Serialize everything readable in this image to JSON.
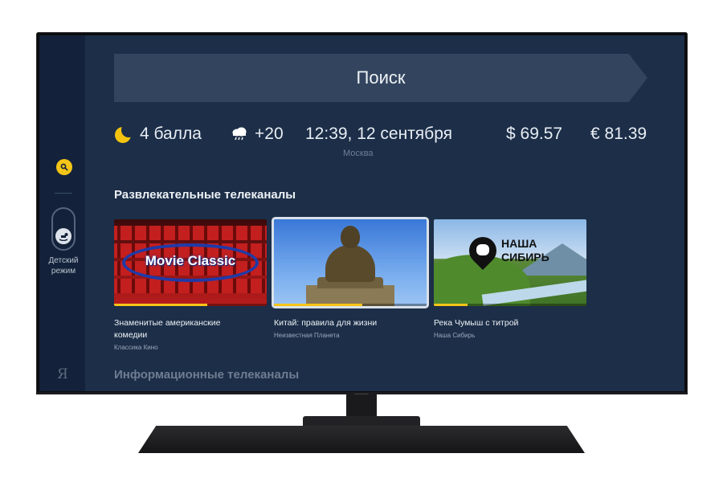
{
  "sidebar": {
    "search_icon": "search-icon",
    "kids_mode_label_1": "Детский",
    "kids_mode_label_2": "режим",
    "logo": "Я"
  },
  "search": {
    "label": "Поиск"
  },
  "info_bar": {
    "traffic_icon": "moon-icon",
    "traffic": "4 балла",
    "weather_icon": "rain-cloud-icon",
    "temperature": "+20",
    "datetime": "12:39, 12 сентября",
    "city": "Москва",
    "usd": "$ 69.57",
    "eur": "€ 81.39"
  },
  "sections": {
    "entertainment_title": "Развлекательные телеканалы",
    "info_title": "Информационные телеканалы"
  },
  "cards": [
    {
      "title_line1": "Знаменитые американские",
      "title_line2": "комедии",
      "channel": "Классика Кино",
      "thumb_text": "Movie Classic",
      "progress": 0.61
    },
    {
      "title_line1": "Китай: правила для жизни",
      "title_line2": "",
      "channel": "Неизвестная Планета",
      "progress": 0.58
    },
    {
      "title_line1": "Река Чумыш с титрой",
      "title_line2": "",
      "channel": "Наша Сибирь",
      "thumb_text_1": "НАША",
      "thumb_text_2": "СИБИРЬ",
      "progress": 0.22
    }
  ],
  "colors": {
    "accent": "#f5c518",
    "screen_bg": "#1c2e48",
    "sidebar_bg": "#13223a"
  }
}
